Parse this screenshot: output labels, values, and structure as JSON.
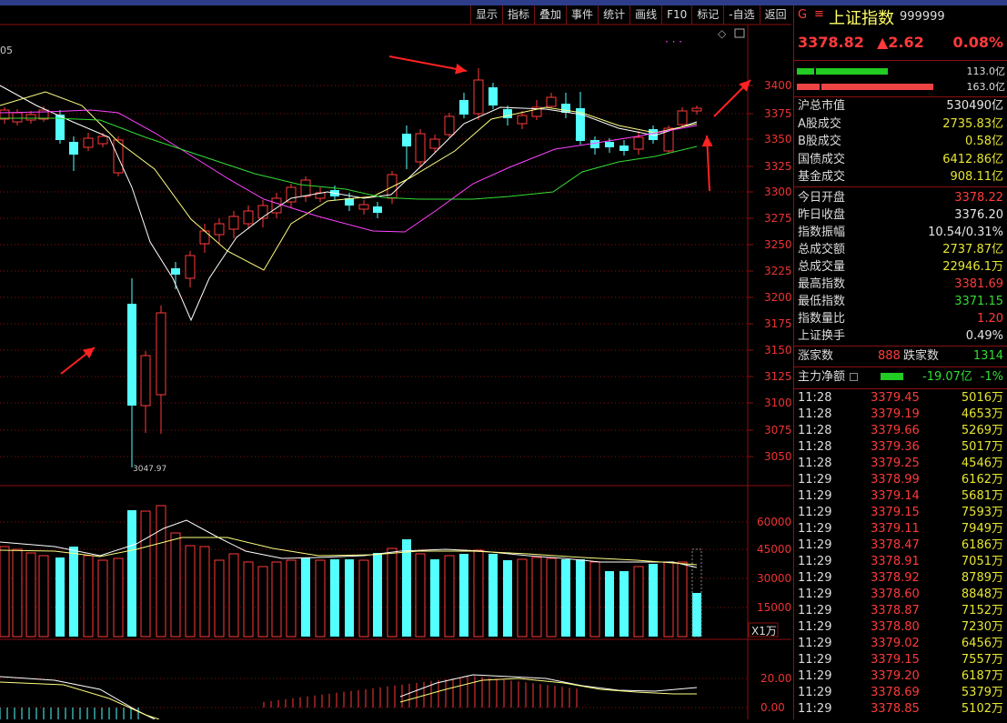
{
  "toolbar": [
    "显示",
    "指标",
    "叠加",
    "事件",
    "统计",
    "画线",
    "F10",
    "标记",
    "-自选",
    "返回"
  ],
  "chart": {
    "corner_label": "05",
    "price_ticks": [
      "3400",
      "3375",
      "3350",
      "3325",
      "3300",
      "3275",
      "3250",
      "3225",
      "3200",
      "3175",
      "3150",
      "3125",
      "3100",
      "3075",
      "3050"
    ],
    "volume_ticks": [
      "60000",
      "45000",
      "30000",
      "15000"
    ],
    "volume_unit": "X1万",
    "macd_ticks": [
      "20.00",
      "0.00"
    ],
    "low_marker": "3047.97"
  },
  "panel": {
    "badge": "G",
    "menu_icon": "≡",
    "name": "上证指数",
    "code": "999999",
    "price": "3378.82",
    "change": "▲2.62",
    "change_pct": "0.08%",
    "bar1_value": "113.0亿",
    "bar2_value": "163.0亿",
    "stats": [
      {
        "label": "沪总市值",
        "value": "530490亿",
        "color": "#e6e6e6"
      },
      {
        "label": "A股成交",
        "value": "2735.83亿",
        "color": "#e6e633"
      },
      {
        "label": "B股成交",
        "value": "0.58亿",
        "color": "#e6e633"
      },
      {
        "label": "国债成交",
        "value": "6412.86亿",
        "color": "#e6e633"
      },
      {
        "label": "基金成交",
        "value": "908.11亿",
        "color": "#e6e633"
      }
    ],
    "stats2": [
      {
        "label": "今日开盘",
        "value": "3378.22",
        "color": "#ff3a3a"
      },
      {
        "label": "昨日收盘",
        "value": "3376.20",
        "color": "#e6e6e6"
      },
      {
        "label": "指数振幅",
        "value": "10.54/0.31%",
        "color": "#e6e6e6"
      },
      {
        "label": "总成交额",
        "value": "2737.87亿",
        "color": "#e6e633"
      },
      {
        "label": "总成交量",
        "value": "22946.1万",
        "color": "#e6e633"
      },
      {
        "label": "最高指数",
        "value": "3381.69",
        "color": "#ff3a3a"
      },
      {
        "label": "最低指数",
        "value": "3371.15",
        "color": "#33dd33"
      },
      {
        "label": "指数量比",
        "value": "1.20",
        "color": "#ff3a3a"
      },
      {
        "label": "上证换手",
        "value": "0.49%",
        "color": "#e6e6e6"
      }
    ],
    "up_label": "涨家数",
    "up_value": "888",
    "down_label": "跌家数",
    "down_value": "1314",
    "fund_label": "主力净额",
    "fund_value": "-19.07亿",
    "fund_pct": "-1%",
    "ticks": [
      {
        "t": "11:28",
        "p": "3379.45",
        "v": "5016万"
      },
      {
        "t": "11:28",
        "p": "3379.19",
        "v": "4653万"
      },
      {
        "t": "11:28",
        "p": "3379.66",
        "v": "5269万"
      },
      {
        "t": "11:28",
        "p": "3379.36",
        "v": "5017万"
      },
      {
        "t": "11:28",
        "p": "3379.25",
        "v": "4546万"
      },
      {
        "t": "11:29",
        "p": "3378.99",
        "v": "6162万"
      },
      {
        "t": "11:29",
        "p": "3379.14",
        "v": "5681万"
      },
      {
        "t": "11:29",
        "p": "3379.15",
        "v": "7593万"
      },
      {
        "t": "11:29",
        "p": "3379.11",
        "v": "7949万"
      },
      {
        "t": "11:29",
        "p": "3378.47",
        "v": "6186万"
      },
      {
        "t": "11:29",
        "p": "3378.91",
        "v": "7051万"
      },
      {
        "t": "11:29",
        "p": "3378.92",
        "v": "8789万"
      },
      {
        "t": "11:29",
        "p": "3378.60",
        "v": "8848万"
      },
      {
        "t": "11:29",
        "p": "3378.87",
        "v": "7152万"
      },
      {
        "t": "11:29",
        "p": "3378.80",
        "v": "7230万"
      },
      {
        "t": "11:29",
        "p": "3379.02",
        "v": "6456万"
      },
      {
        "t": "11:29",
        "p": "3379.15",
        "v": "7557万"
      },
      {
        "t": "11:29",
        "p": "3379.20",
        "v": "6187万"
      },
      {
        "t": "11:29",
        "p": "3378.69",
        "v": "5379万"
      },
      {
        "t": "11:29",
        "p": "3378.85",
        "v": "5102万"
      }
    ]
  },
  "colors": {
    "up": "#ff3a3a",
    "down": "#54ffff",
    "ma5": "#ffffff",
    "ma10": "#ffff80",
    "ma20": "#ff44ff",
    "ma60": "#33dd33",
    "grid": "#8a1010"
  }
}
